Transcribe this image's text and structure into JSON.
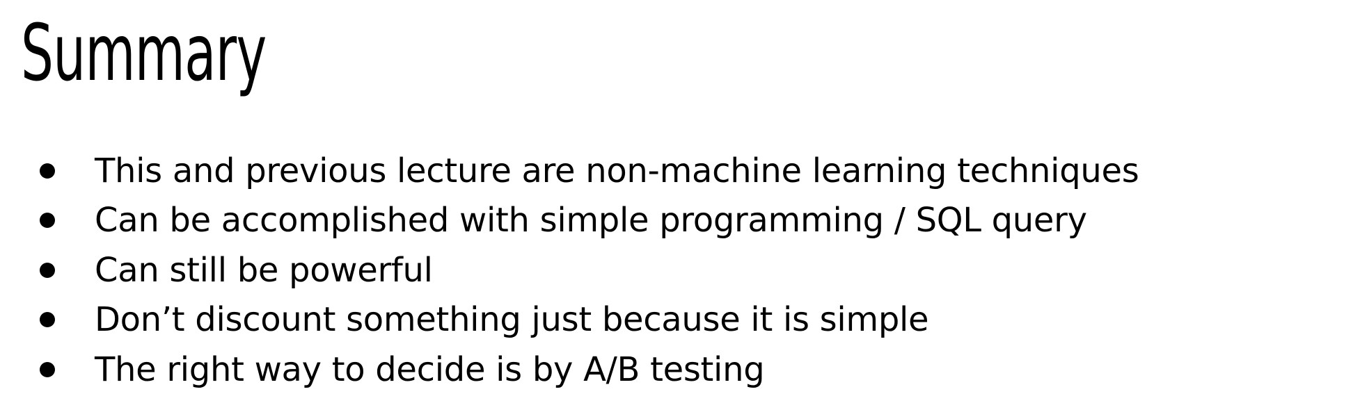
{
  "slide": {
    "title": "Summary",
    "bullets": [
      "This and previous lecture are non-machine learning techniques",
      "Can be accomplished with simple programming / SQL query",
      "Can still be powerful",
      "Don’t discount something just because it is simple",
      "The right way to decide is by A/B testing"
    ]
  }
}
